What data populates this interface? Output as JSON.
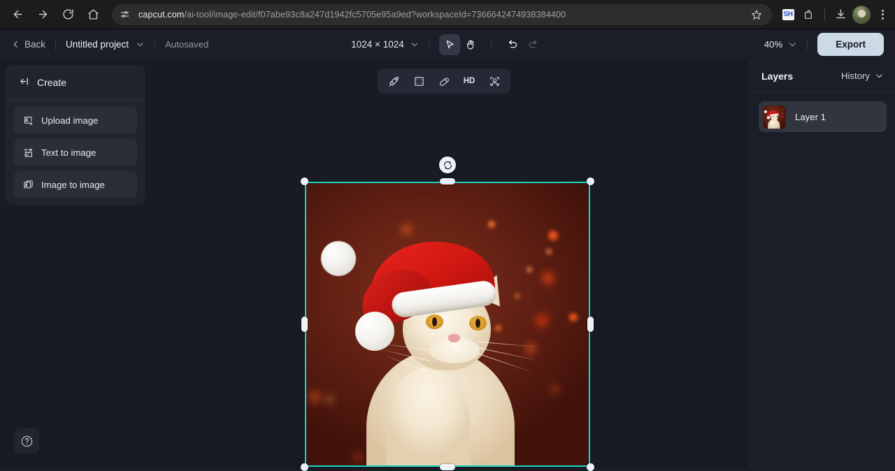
{
  "browser": {
    "url_host": "capcut.com",
    "url_path": "/ai-tool/image-edit/f07abe93c8a247d1942fc5705e95a9ed?workspaceId=7366642474938384400",
    "back_icon": "back-arrow-icon",
    "forward_icon": "forward-arrow-icon",
    "reload_icon": "reload-icon",
    "home_icon": "home-icon",
    "site_info_icon": "site-settings-icon",
    "bookmark_icon": "star-icon",
    "extension_badge": "SH",
    "extensions_icon": "extensions-icon",
    "downloads_icon": "download-icon",
    "profile_icon": "avatar-icon",
    "menu_icon": "three-dots-menu-icon"
  },
  "topbar": {
    "back_label": "Back",
    "project_name": "Untitled project",
    "project_caret_icon": "chevron-down-icon",
    "autosaved_label": "Autosaved",
    "canvas_size": "1024 × 1024",
    "size_caret_icon": "chevron-down-icon",
    "select_tool_icon": "cursor-arrow-icon",
    "hand_tool_icon": "hand-icon",
    "undo_icon": "undo-icon",
    "redo_icon": "redo-icon",
    "zoom_level": "40%",
    "zoom_caret_icon": "chevron-down-icon",
    "export_label": "Export"
  },
  "create_panel": {
    "header_label": "Create",
    "collapse_icon": "collapse-panel-icon",
    "items": [
      {
        "label": "Upload image",
        "icon": "upload-image-icon"
      },
      {
        "label": "Text to image",
        "icon": "text-to-image-icon"
      },
      {
        "label": "Image to image",
        "icon": "image-to-image-icon"
      }
    ]
  },
  "canvas_toolbar": {
    "items": [
      {
        "name": "magic-retouch-icon",
        "label": ""
      },
      {
        "name": "expand-image-icon",
        "label": ""
      },
      {
        "name": "eraser-icon",
        "label": ""
      },
      {
        "name": "hd-upscale-label",
        "label": "HD"
      },
      {
        "name": "portrait-retouch-icon",
        "label": ""
      }
    ]
  },
  "canvas": {
    "rotate_icon": "rotate-icon",
    "selection_color": "#18d6c0",
    "handle_color": "#eef2f6",
    "artwork_description": "Cream colored cat wearing a red Santa hat against a dark red background with bokeh lights"
  },
  "layers_panel": {
    "title": "Layers",
    "history_label": "History",
    "history_caret_icon": "chevron-down-icon",
    "layers": [
      {
        "name": "Layer 1"
      }
    ]
  },
  "help": {
    "icon": "question-mark-icon"
  }
}
